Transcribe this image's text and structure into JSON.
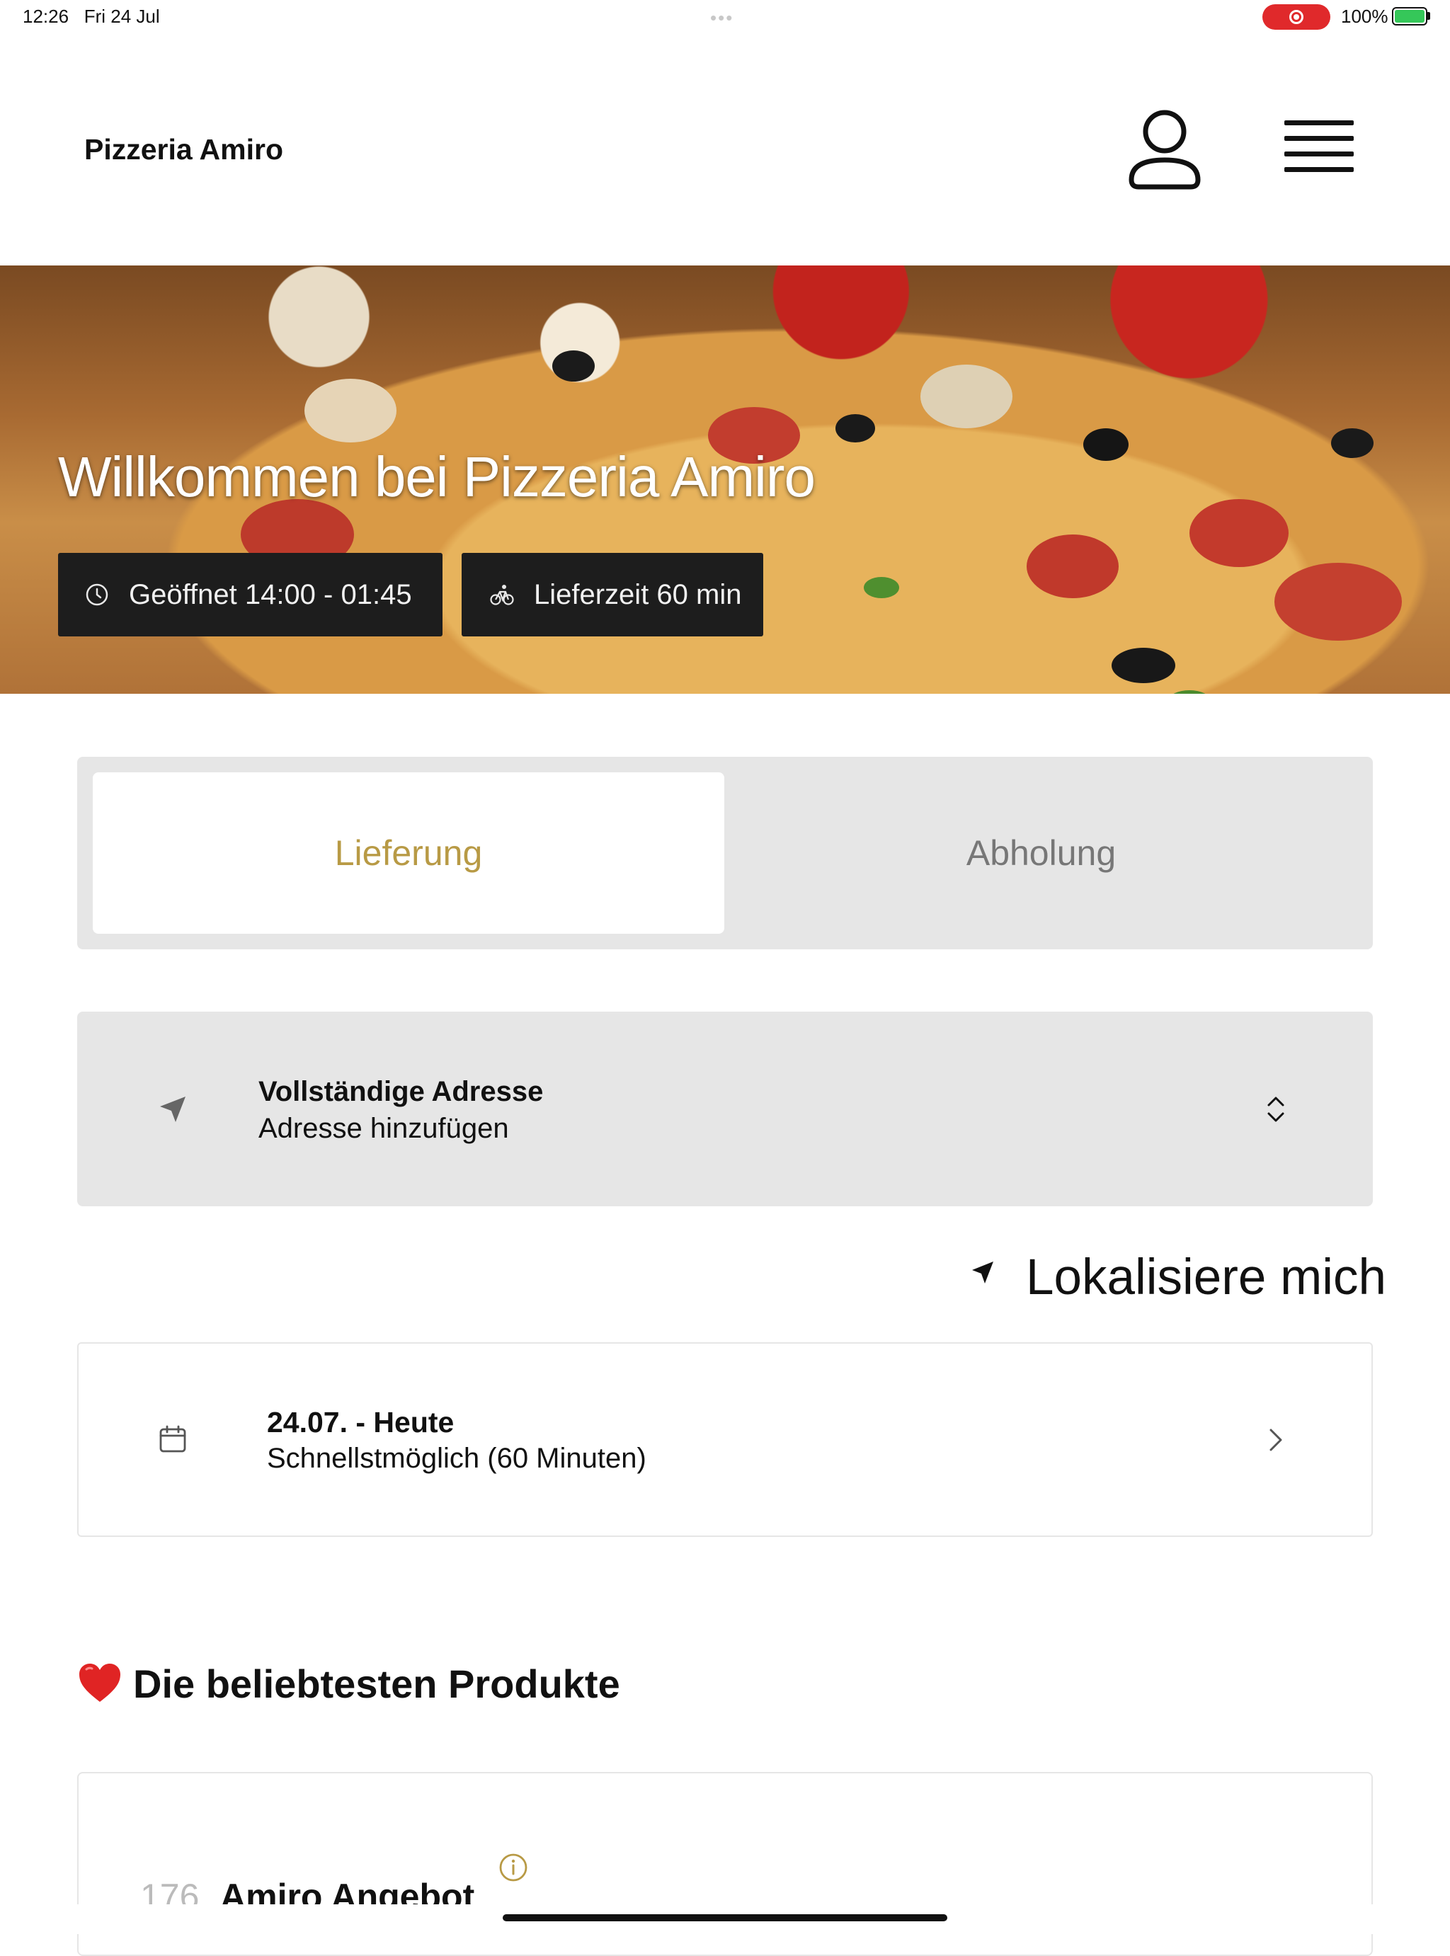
{
  "status_bar": {
    "time": "12:26",
    "date": "Fri 24 Jul",
    "dots": "•••",
    "battery": "100%"
  },
  "header": {
    "brand": "Pizzeria Amiro"
  },
  "hero": {
    "title": "Willkommen bei Pizzeria Amiro",
    "hours": "Geöffnet 14:00 - 01:45",
    "delivery_time": "Lieferzeit 60 min"
  },
  "tabs": {
    "active": "Lieferung",
    "inactive": "Abholung"
  },
  "address": {
    "title": "Vollständige Adresse",
    "subtitle": "Adresse hinzufügen"
  },
  "locate": {
    "label": "Lokalisiere mich"
  },
  "schedule": {
    "title": "24.07. - Heute",
    "subtitle": "Schnellstmöglich (60 Minuten)"
  },
  "popular": {
    "title": "Die beliebtesten Produkte",
    "products": [
      {
        "number": "176",
        "name": "Amiro Angebot"
      }
    ]
  },
  "colors": {
    "accent": "#b89a45",
    "chip_bg": "#1d1d1d",
    "panel_bg": "#e6e6e6",
    "record": "#e0292b",
    "battery": "#35c759"
  },
  "icons": [
    "record-icon",
    "battery-icon",
    "user-icon",
    "hamburger-menu-icon",
    "clock-icon",
    "bicycle-icon",
    "navigation-arrow-icon",
    "chevron-up-down-icon",
    "location-arrow-icon",
    "calendar-icon",
    "chevron-right-icon",
    "heart-icon",
    "info-icon"
  ]
}
